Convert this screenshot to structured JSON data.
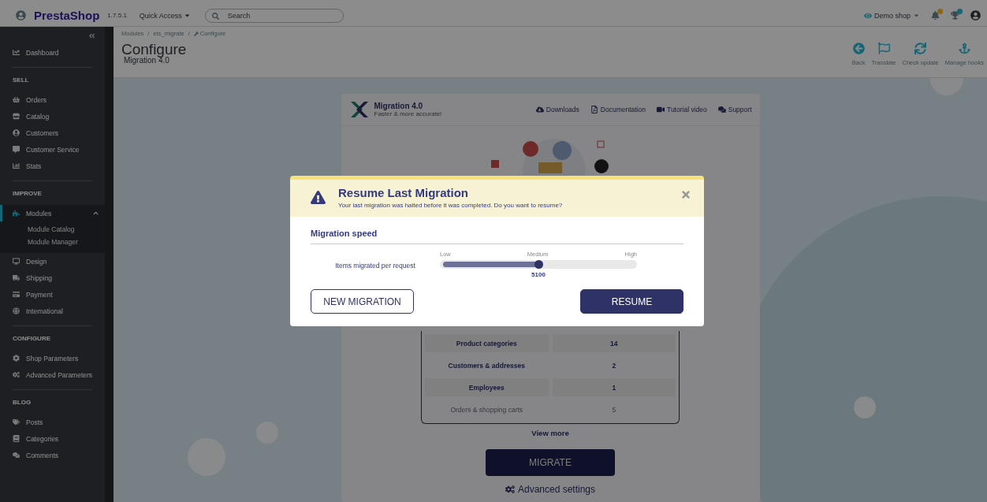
{
  "header": {
    "logo": "PrestaShop",
    "version": "1.7.5.1",
    "quick_access": "Quick Access",
    "search": {
      "placeholder": "Search"
    },
    "shop": "Demo shop"
  },
  "sidebar": {
    "top": [
      {
        "label": "Dashboard",
        "selected": false
      }
    ],
    "sections": [
      {
        "title": "SELL",
        "items": [
          {
            "label": "Orders",
            "selected": false
          },
          {
            "label": "Catalog",
            "selected": false
          },
          {
            "label": "Customers",
            "selected": false
          },
          {
            "label": "Customer Service",
            "selected": false
          },
          {
            "label": "Stats",
            "selected": false
          }
        ]
      },
      {
        "title": "IMPROVE",
        "items": [
          {
            "label": "Modules",
            "selected": true,
            "expanded": true,
            "children": [
              {
                "label": "Module Catalog",
                "selected": false
              },
              {
                "label": "Module Manager",
                "selected": false
              }
            ]
          },
          {
            "label": "Design",
            "selected": false
          },
          {
            "label": "Shipping",
            "selected": false
          },
          {
            "label": "Payment",
            "selected": false
          },
          {
            "label": "International",
            "selected": false
          }
        ]
      },
      {
        "title": "CONFIGURE",
        "items": [
          {
            "label": "Shop Parameters",
            "selected": false
          },
          {
            "label": "Advanced Parameters",
            "selected": false
          }
        ]
      },
      {
        "title": "BLOG",
        "items": [
          {
            "label": "Posts",
            "selected": false
          },
          {
            "label": "Categories",
            "selected": false
          },
          {
            "label": "Comments",
            "selected": false
          }
        ]
      }
    ]
  },
  "page_header": {
    "breadcrumbs": [
      "Modules",
      "ets_migrate",
      "Configure"
    ],
    "breadcrumb_separator": "/",
    "title": "Configure",
    "subtitle": "Migration 4.0",
    "toolbar": [
      "Back",
      "Translate",
      "Check update",
      "Manage hooks"
    ]
  },
  "module_card": {
    "name": "Migration 4.0",
    "tagline": "Faster & more accurate!",
    "links": [
      "Downloads",
      "Documentation",
      "Tutorial video",
      "Support"
    ],
    "table": {
      "rows": [
        {
          "label": "Product categories",
          "value": "14",
          "faded": false
        },
        {
          "label": "Customers & addresses",
          "value": "2",
          "faded": false
        },
        {
          "label": "Employees",
          "value": "1",
          "faded": false
        },
        {
          "label": "Orders & shopping carts",
          "value": "5",
          "faded": true
        }
      ]
    },
    "view_more": "View more",
    "migrate_button": "MIGRATE",
    "advanced": "Advanced settings"
  },
  "dialog": {
    "title": "Resume Last Migration",
    "message": "Your last migration was halted before it was completed. Do you want to resume?",
    "section": "Migration speed",
    "slider": {
      "label": "Items migrated per request",
      "ticks": [
        "Low",
        "Medium",
        "High"
      ],
      "level": 0.5,
      "reading": "5100"
    },
    "buttons": [
      {
        "label": "NEW MIGRATION",
        "kind": "secondary"
      },
      {
        "label": "RESUME",
        "kind": "primary"
      }
    ]
  }
}
